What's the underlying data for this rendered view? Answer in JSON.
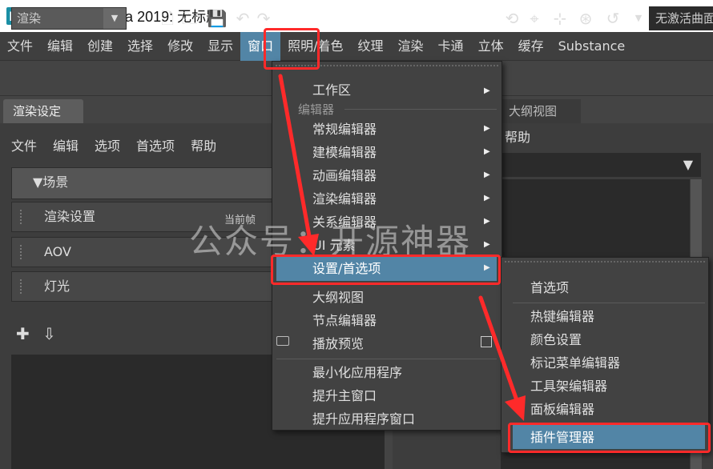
{
  "window": {
    "logo": "M",
    "title": "Autodesk Maya 2019: 无标题*"
  },
  "menubar": {
    "items": [
      "文件",
      "编辑",
      "创建",
      "选择",
      "修改",
      "显示",
      "窗口",
      "照明/着色",
      "纹理",
      "渲染",
      "卡通",
      "立体",
      "缓存",
      "Substance"
    ],
    "active": "窗口"
  },
  "toolbar": {
    "render_select": "渲染",
    "curve_select": "无激活曲面"
  },
  "left_panel": {
    "tab": "渲染设定",
    "menus": [
      "文件",
      "编辑",
      "选项",
      "首选项",
      "帮助"
    ],
    "rows": {
      "scene": "▼场景",
      "render_settings": "渲染设置",
      "aov": "AOV",
      "lights": "灯光"
    },
    "current_frame": "当前帧"
  },
  "right_panel": {
    "tab": "大纲视图",
    "help": "帮助"
  },
  "window_menu": {
    "workspace": "工作区",
    "editors_section": "编辑器",
    "editors": [
      "常规编辑器",
      "建模编辑器",
      "动画编辑器",
      "渲染编辑器",
      "关系编辑器",
      "UI 元素"
    ],
    "settings": "设置/首选项",
    "others": [
      "大纲视图",
      "节点编辑器",
      "播放预览"
    ],
    "window_ops": [
      "最小化应用程序",
      "提升主窗口",
      "提升应用程序窗口"
    ]
  },
  "settings_menu": {
    "items": [
      "首选项",
      "热键编辑器",
      "颜色设置",
      "标记菜单编辑器",
      "工具架编辑器",
      "面板编辑器",
      "插件管理器"
    ],
    "highlighted": "插件管理器"
  },
  "watermark": "公众号：开源神器",
  "colors": {
    "highlight": "#5285a6",
    "annotation": "#ff2a2a"
  }
}
